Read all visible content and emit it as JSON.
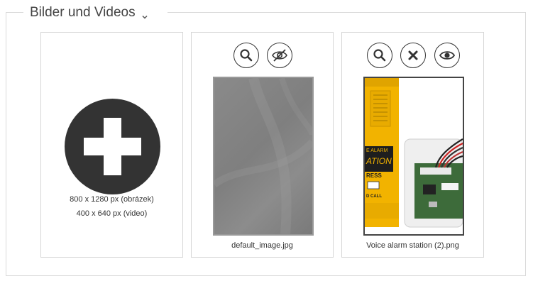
{
  "section": {
    "title": "Bilder und Videos"
  },
  "add_card": {
    "dim_image": "800 x 1280 px (obrázek)",
    "dim_video": "400 x 640 px (video)"
  },
  "items": [
    {
      "filename": "default_image.jpg",
      "actions": [
        "zoom-icon",
        "eye-off-icon"
      ]
    },
    {
      "filename": "Voice alarm station (2).png",
      "actions": [
        "zoom-icon",
        "delete-icon",
        "eye-icon"
      ]
    }
  ],
  "voice_thumb_text": {
    "line1": "E ALARM",
    "line2": "ATION",
    "line3": "RESS",
    "line4": "D CALL"
  },
  "colors": {
    "icon_dark": "#333333",
    "border": "#d6d6d6",
    "accent_yellow": "#f2b300"
  }
}
